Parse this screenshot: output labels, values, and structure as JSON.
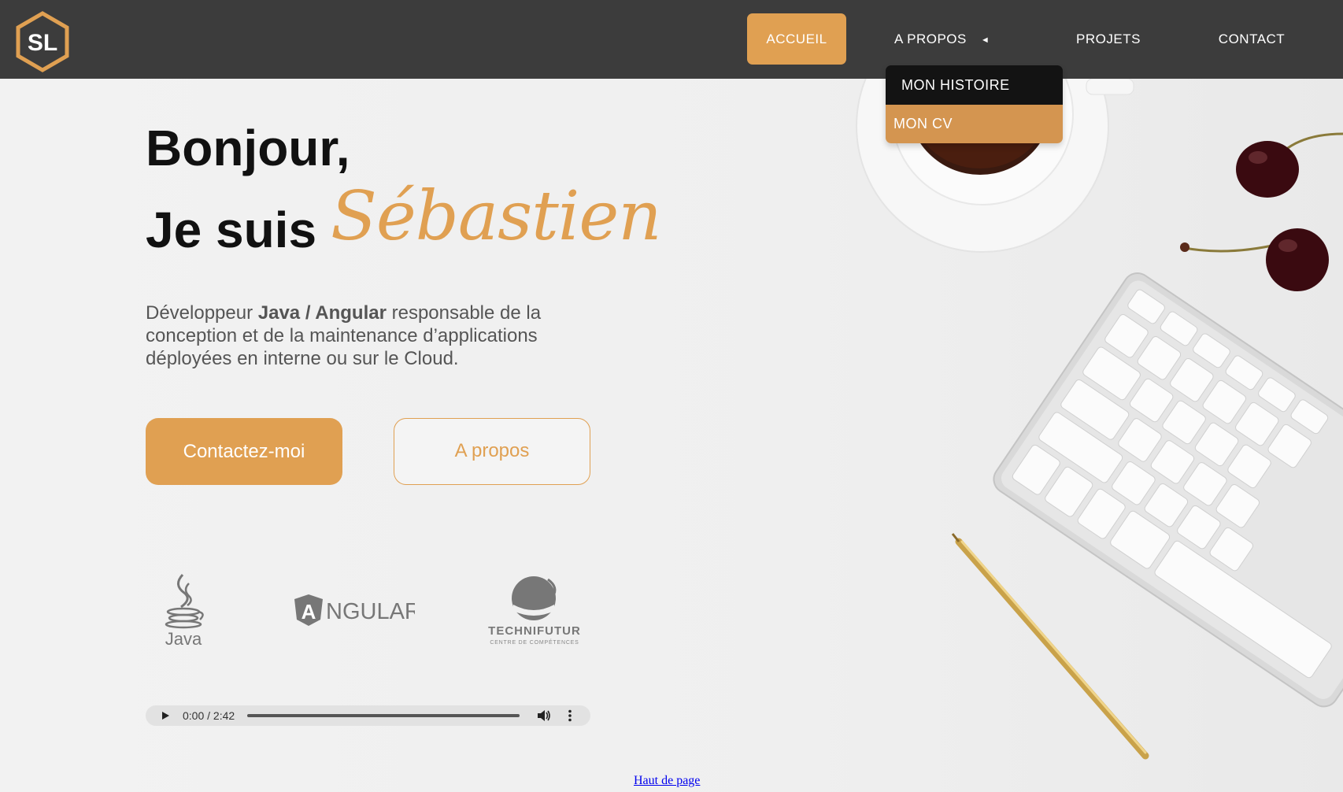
{
  "header": {
    "logo_text": "SL",
    "nav": {
      "accueil": "ACCUEIL",
      "apropos": "A PROPOS",
      "apropos_caret": "◄",
      "projets": "PROJETS",
      "contact": "CONTACT"
    },
    "dropdown": {
      "histoire": "MON HISTOIRE",
      "cv": "MON CV"
    }
  },
  "hero": {
    "greeting": "Bonjour,",
    "intro": "Je suis",
    "name": "Sébastien",
    "desc_pre": "Développeur ",
    "desc_bold": "Java / Angular",
    "desc_post": " responsable de la conception et de la maintenance d’applications déployées en interne ou sur le Cloud.",
    "btn_contact": "Contactez-moi",
    "btn_about": "A propos"
  },
  "logos": {
    "java": "Java",
    "angular": "NGULAR",
    "angular_letter": "A",
    "techni": "TECHNIFUTUR",
    "techni_sub": "CENTRE DE COMPÉTENCES"
  },
  "audio": {
    "time": "0:00 / 2:42",
    "progress": 0
  },
  "footer": {
    "top_link": "Haut de page"
  },
  "colors": {
    "accent": "#e0a052",
    "header_bg": "#3c3c3c",
    "dropdown_dark": "#131313"
  }
}
